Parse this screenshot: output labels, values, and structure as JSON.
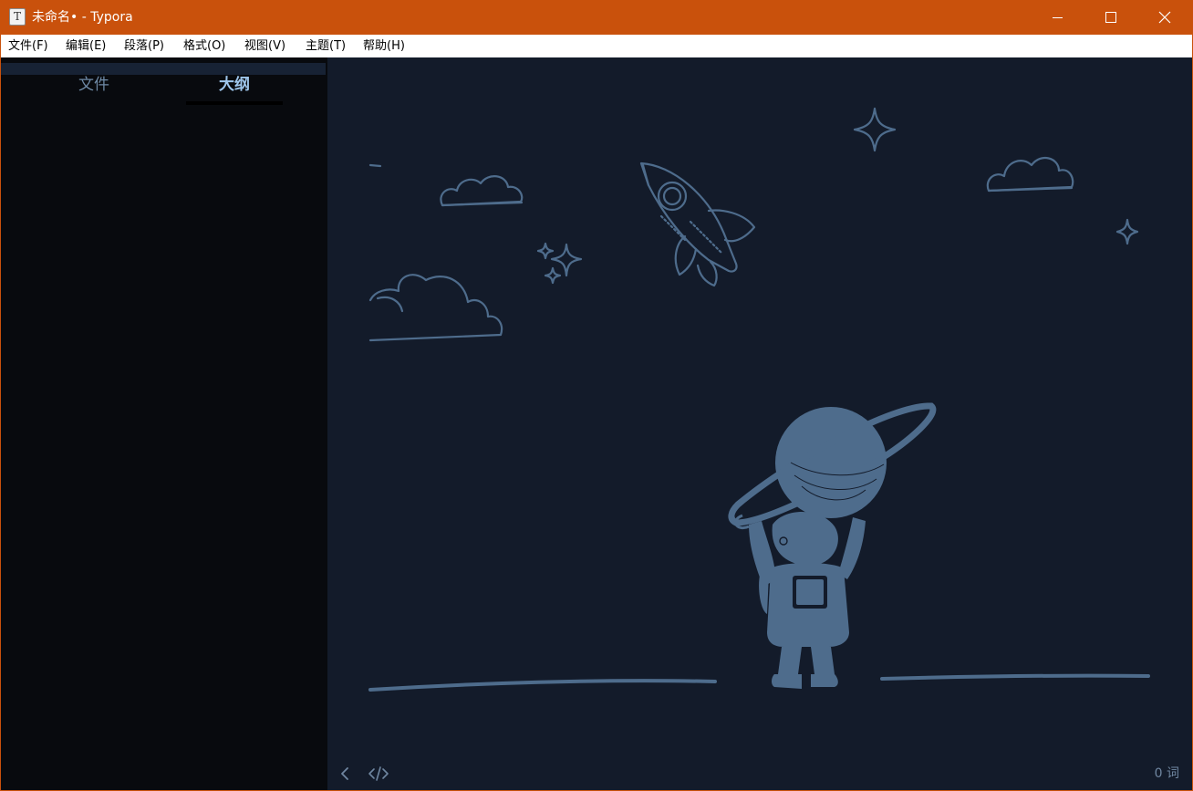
{
  "window": {
    "title": "未命名• - Typora",
    "app_icon_letter": "T",
    "accent_color": "#c9510c"
  },
  "menu": {
    "items": [
      "文件(F)",
      "编辑(E)",
      "段落(P)",
      "格式(O)",
      "视图(V)",
      "主题(T)",
      "帮助(H)"
    ]
  },
  "sidebar": {
    "tabs": [
      {
        "label": "文件",
        "active": false
      },
      {
        "label": "大纲",
        "active": true
      }
    ]
  },
  "editor": {
    "background_color": "#131b2a",
    "illustration_color": "#4e6c8c",
    "word_count": "0 词"
  },
  "icons": {
    "toggle_sidebar": "chevron-left-icon",
    "source_mode": "code-icon",
    "minimize": "minimize-icon",
    "maximize": "maximize-icon",
    "close": "close-icon"
  }
}
